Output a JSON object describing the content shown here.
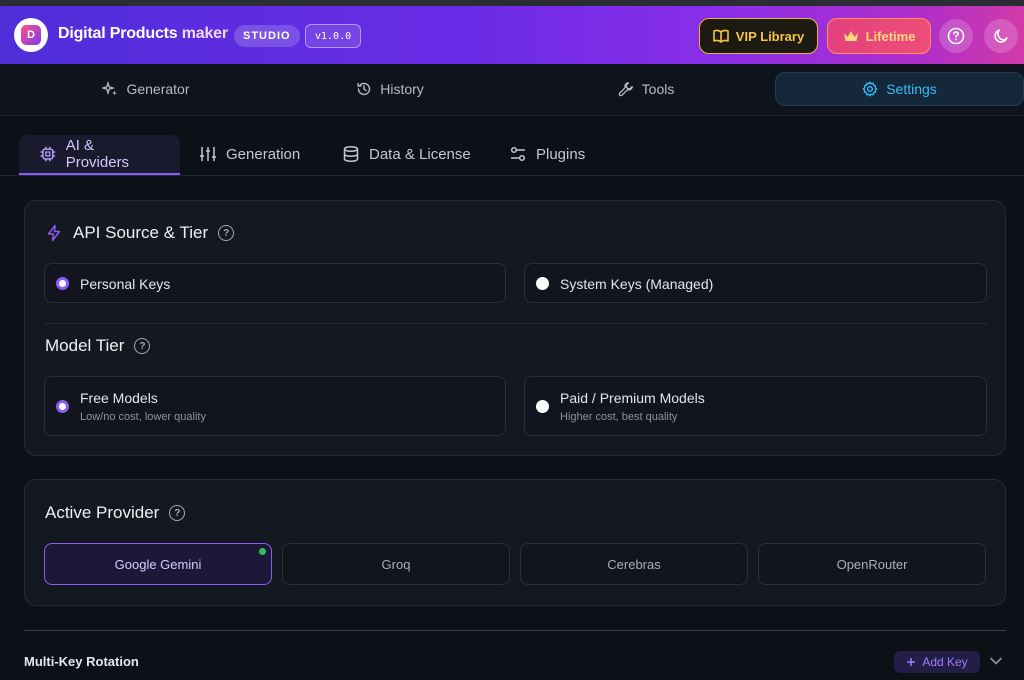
{
  "header": {
    "app_title_main": "Digital Products",
    "app_title_accent": "maker",
    "studio_badge": "STUDIO",
    "version": "v1.0.0",
    "vip_label": "VIP Library",
    "lifetime_label": "Lifetime"
  },
  "main_tabs": [
    {
      "label": "Generator",
      "icon": "sparkles-icon"
    },
    {
      "label": "History",
      "icon": "history-icon"
    },
    {
      "label": "Tools",
      "icon": "wrench-icon"
    },
    {
      "label": "Settings",
      "icon": "gear-icon",
      "active": true
    }
  ],
  "sub_tabs": [
    {
      "label": "AI & Providers",
      "icon": "chip-icon",
      "active": true
    },
    {
      "label": "Generation",
      "icon": "sliders-icon"
    },
    {
      "label": "Data & License",
      "icon": "database-icon"
    },
    {
      "label": "Plugins",
      "icon": "toggles-icon"
    }
  ],
  "api_source": {
    "title": "API Source & Tier",
    "options": [
      {
        "label": "Personal Keys",
        "checked": true
      },
      {
        "label": "System Keys (Managed)",
        "checked": false
      }
    ]
  },
  "model_tier": {
    "title": "Model Tier",
    "options": [
      {
        "label": "Free Models",
        "desc": "Low/no cost, lower quality",
        "checked": true
      },
      {
        "label": "Paid / Premium Models",
        "desc": "Higher cost, best quality",
        "checked": false
      }
    ]
  },
  "active_provider": {
    "title": "Active Provider",
    "providers": [
      "Google Gemini",
      "Groq",
      "Cerebras",
      "OpenRouter"
    ],
    "selected": "Google Gemini"
  },
  "multi_key": {
    "title": "Multi-Key Rotation",
    "add_label": "Add Key"
  },
  "colors": {
    "accent": "#8b5cf6",
    "settings_blue": "#38bdf8",
    "vip_gold": "#f5c542",
    "status_green": "#22c55e"
  }
}
